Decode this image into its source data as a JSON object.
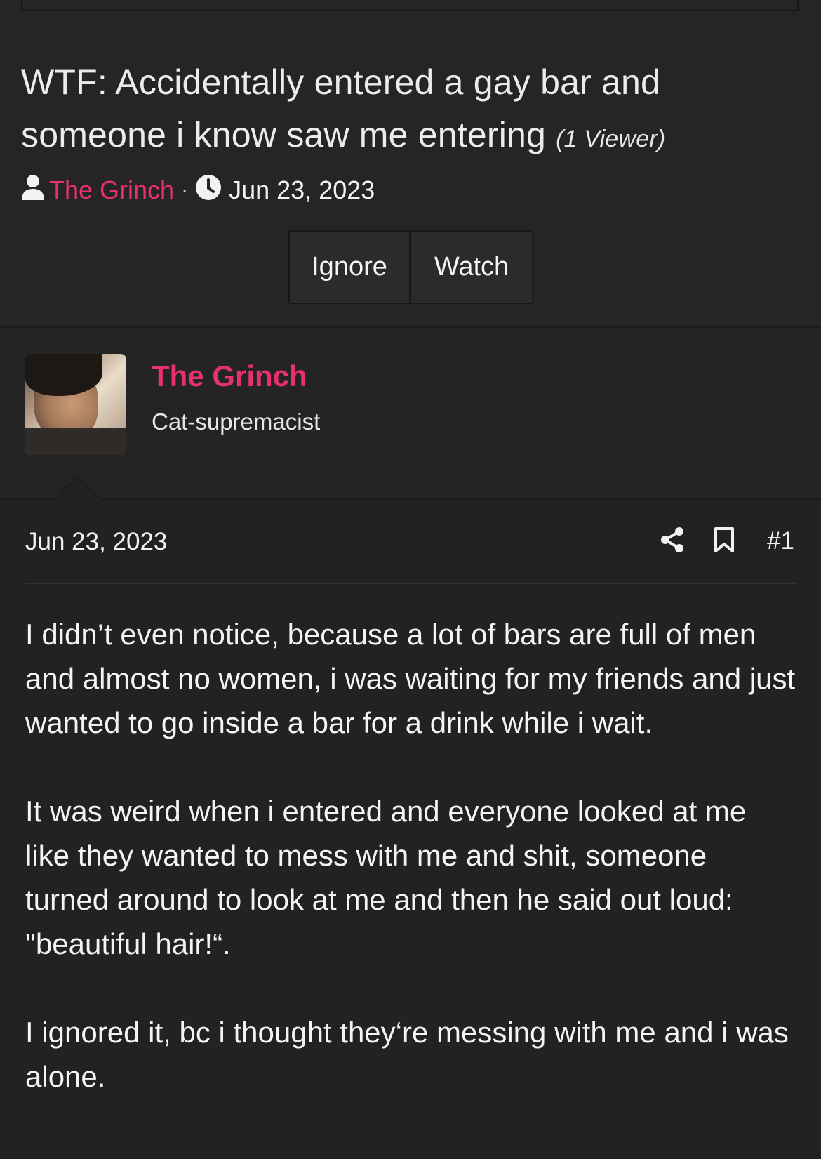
{
  "thread": {
    "title": "WTF: Accidentally entered a gay bar and someone i know saw me entering",
    "viewer_note": "(1 Viewer)",
    "author": "The Grinch",
    "separator": "·",
    "date": "Jun 23, 2023",
    "actions": {
      "ignore_label": "Ignore",
      "watch_label": "Watch"
    }
  },
  "poster": {
    "username": "The Grinch",
    "user_title": "Cat-supremacist"
  },
  "post": {
    "date": "Jun 23, 2023",
    "post_number": "#1",
    "paragraphs": [
      "I didn’t even notice, because a lot of bars are full of men and almost no women, i was waiting for my friends and just wanted to go inside a bar for a drink while i wait.",
      "It was weird when i entered and everyone looked at me like they wanted to mess with me and shit, someone turned around to look at me and then he said out loud: \"beautiful hair!“.",
      "I ignored it, bc i thought they‘re messing with me and i was alone."
    ]
  },
  "colors": {
    "accent": "#e8316c",
    "background": "#252526",
    "post_background": "#222223",
    "text": "#f2f2f2"
  },
  "icons": {
    "author": "user-icon",
    "date": "clock-icon",
    "share": "share-icon",
    "bookmark": "bookmark-icon"
  }
}
